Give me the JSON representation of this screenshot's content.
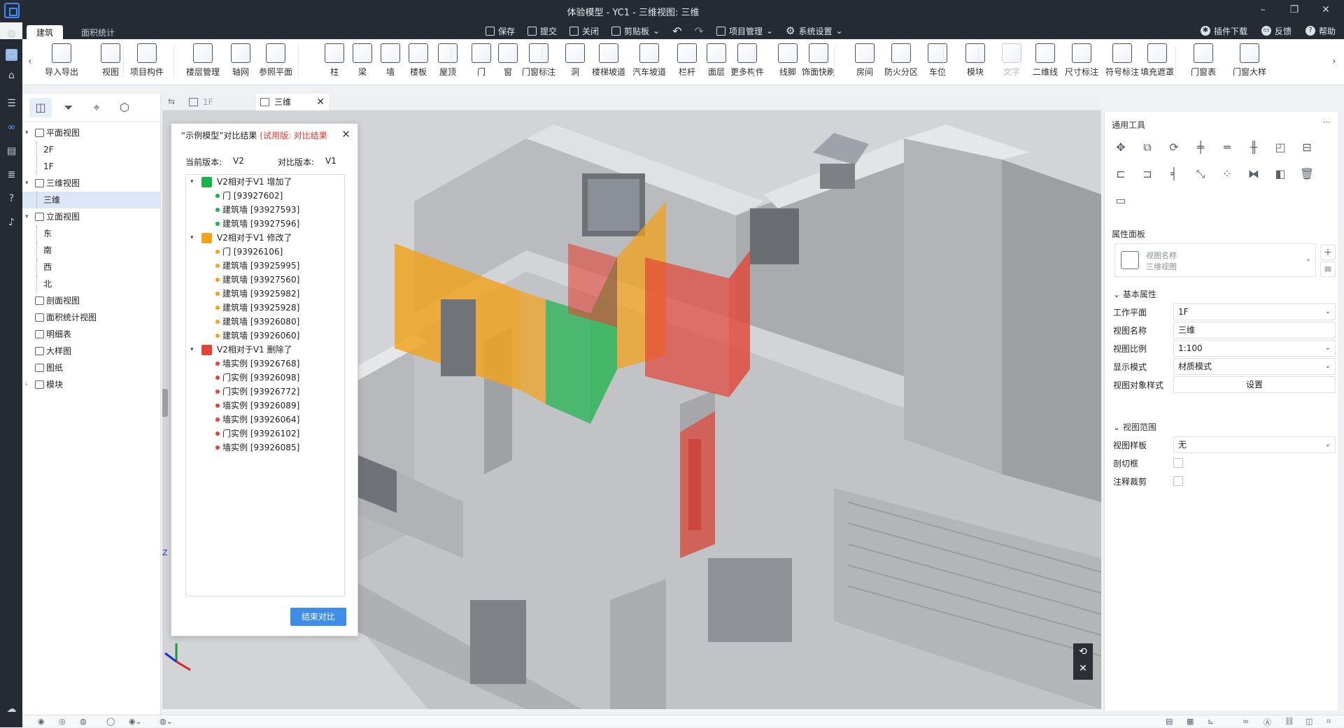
{
  "window": {
    "title": "体验模型 - YC1 - 三维视图: 三维",
    "controls": {
      "min": "–",
      "max": "❐",
      "close": "✕"
    }
  },
  "app_tabs": [
    "建筑",
    "面积统计"
  ],
  "quick": [
    "保存",
    "提交",
    "关闭",
    "剪贴板",
    "项目管理",
    "系统设置"
  ],
  "right_links": [
    "插件下载",
    "反馈",
    "帮助"
  ],
  "toolbar": {
    "nav_left": "‹",
    "nav_right": "›",
    "buttons": [
      "导入导出",
      "视图",
      "项目构件",
      "楼层管理",
      "轴网",
      "参照平面",
      "柱",
      "梁",
      "墙",
      "楼板",
      "屋顶",
      "门",
      "窗",
      "门窗标注",
      "洞",
      "楼梯坡道",
      "汽车坡道",
      "栏杆",
      "面层",
      "更多构件",
      "线脚",
      "饰面快刷",
      "房间",
      "防火分区",
      "车位",
      "模块",
      "文字",
      "二维线",
      "尺寸标注",
      "符号标注",
      "填充遮罩",
      "门窗表",
      "门窗大样"
    ]
  },
  "tree": [
    {
      "label": "平面视图",
      "level": 0,
      "arrow": "▾",
      "icon": true
    },
    {
      "label": "2F",
      "level": 1
    },
    {
      "label": "1F",
      "level": 1
    },
    {
      "label": "三维视图",
      "level": 0,
      "arrow": "▾",
      "icon": true
    },
    {
      "label": "三维",
      "level": 1,
      "selected": true
    },
    {
      "label": "立面视图",
      "level": 0,
      "arrow": "▾",
      "icon": true
    },
    {
      "label": "东",
      "level": 1
    },
    {
      "label": "南",
      "level": 1
    },
    {
      "label": "西",
      "level": 1
    },
    {
      "label": "北",
      "level": 1
    },
    {
      "label": "剖面视图",
      "level": 0,
      "icon": true
    },
    {
      "label": "面积统计视图",
      "level": 0,
      "icon": true
    },
    {
      "label": "明细表",
      "level": 0,
      "icon": true
    },
    {
      "label": "大样图",
      "level": 0,
      "icon": true
    },
    {
      "label": "图纸",
      "level": 0,
      "icon": true
    },
    {
      "label": "模块",
      "level": 0,
      "arrow": "›",
      "icon": true
    }
  ],
  "view_tabs": [
    {
      "label": "1F",
      "active": false
    },
    {
      "label": "三维",
      "active": true,
      "close": "✕"
    }
  ],
  "compare": {
    "title_main": "“示例模型”对比结果",
    "title_trial": "(试用版: 对比结果",
    "close": "✕",
    "current_label": "当前版本:",
    "current_value": "V2",
    "compare_label": "对比版本:",
    "compare_value": "V1",
    "groups": [
      {
        "label": "V2相对于V1  增加了",
        "color": "#19b34a",
        "items": [
          "门 [93927602]",
          "建筑墙 [93927593]",
          "建筑墙 [93927596]"
        ]
      },
      {
        "label": "V2相对于V1  修改了",
        "color": "#f2a21b",
        "items": [
          "门 [93926106]",
          "建筑墙 [93925995]",
          "建筑墙 [93927560]",
          "建筑墙 [93925982]",
          "建筑墙 [93925928]",
          "建筑墙 [93926080]",
          "建筑墙 [93926060]"
        ]
      },
      {
        "label": "V2相对于V1  删除了",
        "color": "#e24436",
        "items": [
          "墙实例 [93926768]",
          "门实例 [93926098]",
          "门实例 [93926772]",
          "墙实例 [93926089]",
          "墙实例 [93926064]",
          "门实例 [93926102]",
          "墙实例 [93926085]"
        ]
      }
    ],
    "end_button": "结束对比"
  },
  "axis": {
    "x": "X",
    "y": "Y",
    "z": "Z"
  },
  "right_panel": {
    "tools_title": "通用工具",
    "more": "···",
    "props_title": "属性面板",
    "card_name": "视图名称",
    "card_sub": "三维视图",
    "sec_basic": "基本属性",
    "rows": [
      {
        "key": "工作平面",
        "value": "1F",
        "dd": true
      },
      {
        "key": "视图名称",
        "value": "三维",
        "dd": false
      },
      {
        "key": "视图比例",
        "value": "1:100",
        "dd": true
      },
      {
        "key": "显示模式",
        "value": "材质模式",
        "dd": true
      },
      {
        "key": "视图对象样式",
        "value": "设置",
        "dd": false,
        "btn": true
      }
    ],
    "sec_range": "视图范围",
    "rows2": [
      {
        "key": "视图样板",
        "value": "无",
        "dd": true
      }
    ],
    "checks": [
      "剖切框",
      "注释裁剪"
    ]
  },
  "colors": {
    "added": "#19b34a",
    "modified": "#f2a21b",
    "deleted": "#e24436",
    "accent": "#3f8dea",
    "titlebar": "#252a33"
  }
}
